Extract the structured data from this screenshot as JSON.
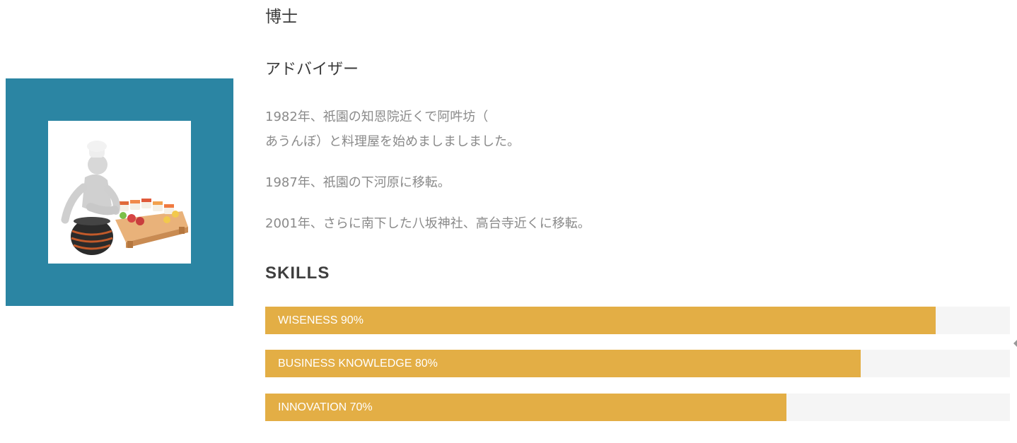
{
  "profile": {
    "name": "博士",
    "role": "アドバイザー",
    "photo_alt": "chef-with-sushi-illustration"
  },
  "history": {
    "line1a": "1982年、祇園の知恩院近くで阿吽坊（",
    "line1b": "あうんぼ）と料理屋を始めましましました。",
    "line2": "1987年、祇園の下河原に移転。",
    "line3": "2001年、さらに南下した八坂神社、高台寺近くに移転。"
  },
  "skills": {
    "title": "SKILLS",
    "items": [
      {
        "label": "WISENESS 90%",
        "percent": 90
      },
      {
        "label": "BUSINESS KNOWLEDGE 80%",
        "percent": 80
      },
      {
        "label": "INNOVATION 70%",
        "percent": 70
      }
    ]
  },
  "colors": {
    "photo_frame": "#2b85a3",
    "bar_fill": "#e3ae45",
    "bar_track": "#f5f5f5"
  }
}
